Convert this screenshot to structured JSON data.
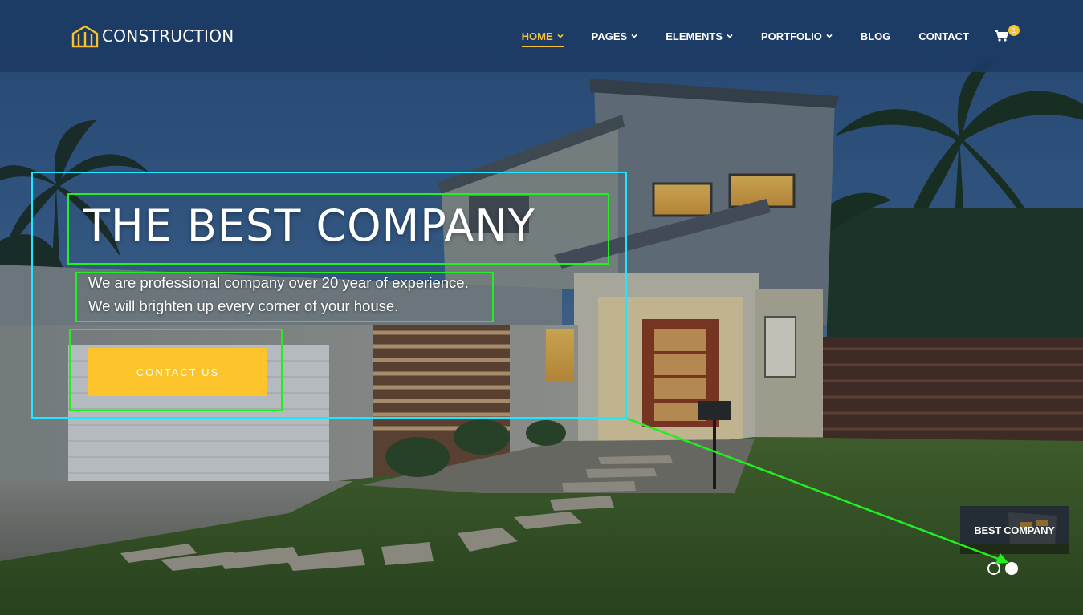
{
  "brand": {
    "name": "CONSTRUCTION",
    "icon": "building-logo-icon",
    "accent": "#f9c22e"
  },
  "nav": {
    "items": [
      {
        "label": "HOME",
        "has_dropdown": true,
        "active": true
      },
      {
        "label": "PAGES",
        "has_dropdown": true,
        "active": false
      },
      {
        "label": "ELEMENTS",
        "has_dropdown": true,
        "active": false
      },
      {
        "label": "PORTFOLIO",
        "has_dropdown": true,
        "active": false
      },
      {
        "label": "BLOG",
        "has_dropdown": false,
        "active": false
      },
      {
        "label": "CONTACT",
        "has_dropdown": false,
        "active": false
      }
    ],
    "cart": {
      "icon": "shopping-cart-icon",
      "count": "1"
    }
  },
  "hero": {
    "title": "THE BEST COMPANY",
    "subtitle_lines": [
      "We are professional company over 20 year of experience.",
      "We will brighten up every corner of your house."
    ],
    "cta_label": "CONTACT US",
    "cta_color": "#fcc32a"
  },
  "slider": {
    "thumbnail_label": "BEST COMPANY",
    "slide_count": 2,
    "active_slide": 2
  },
  "annotation_colors": {
    "region": "#22e6ff",
    "element": "#22ee22"
  }
}
